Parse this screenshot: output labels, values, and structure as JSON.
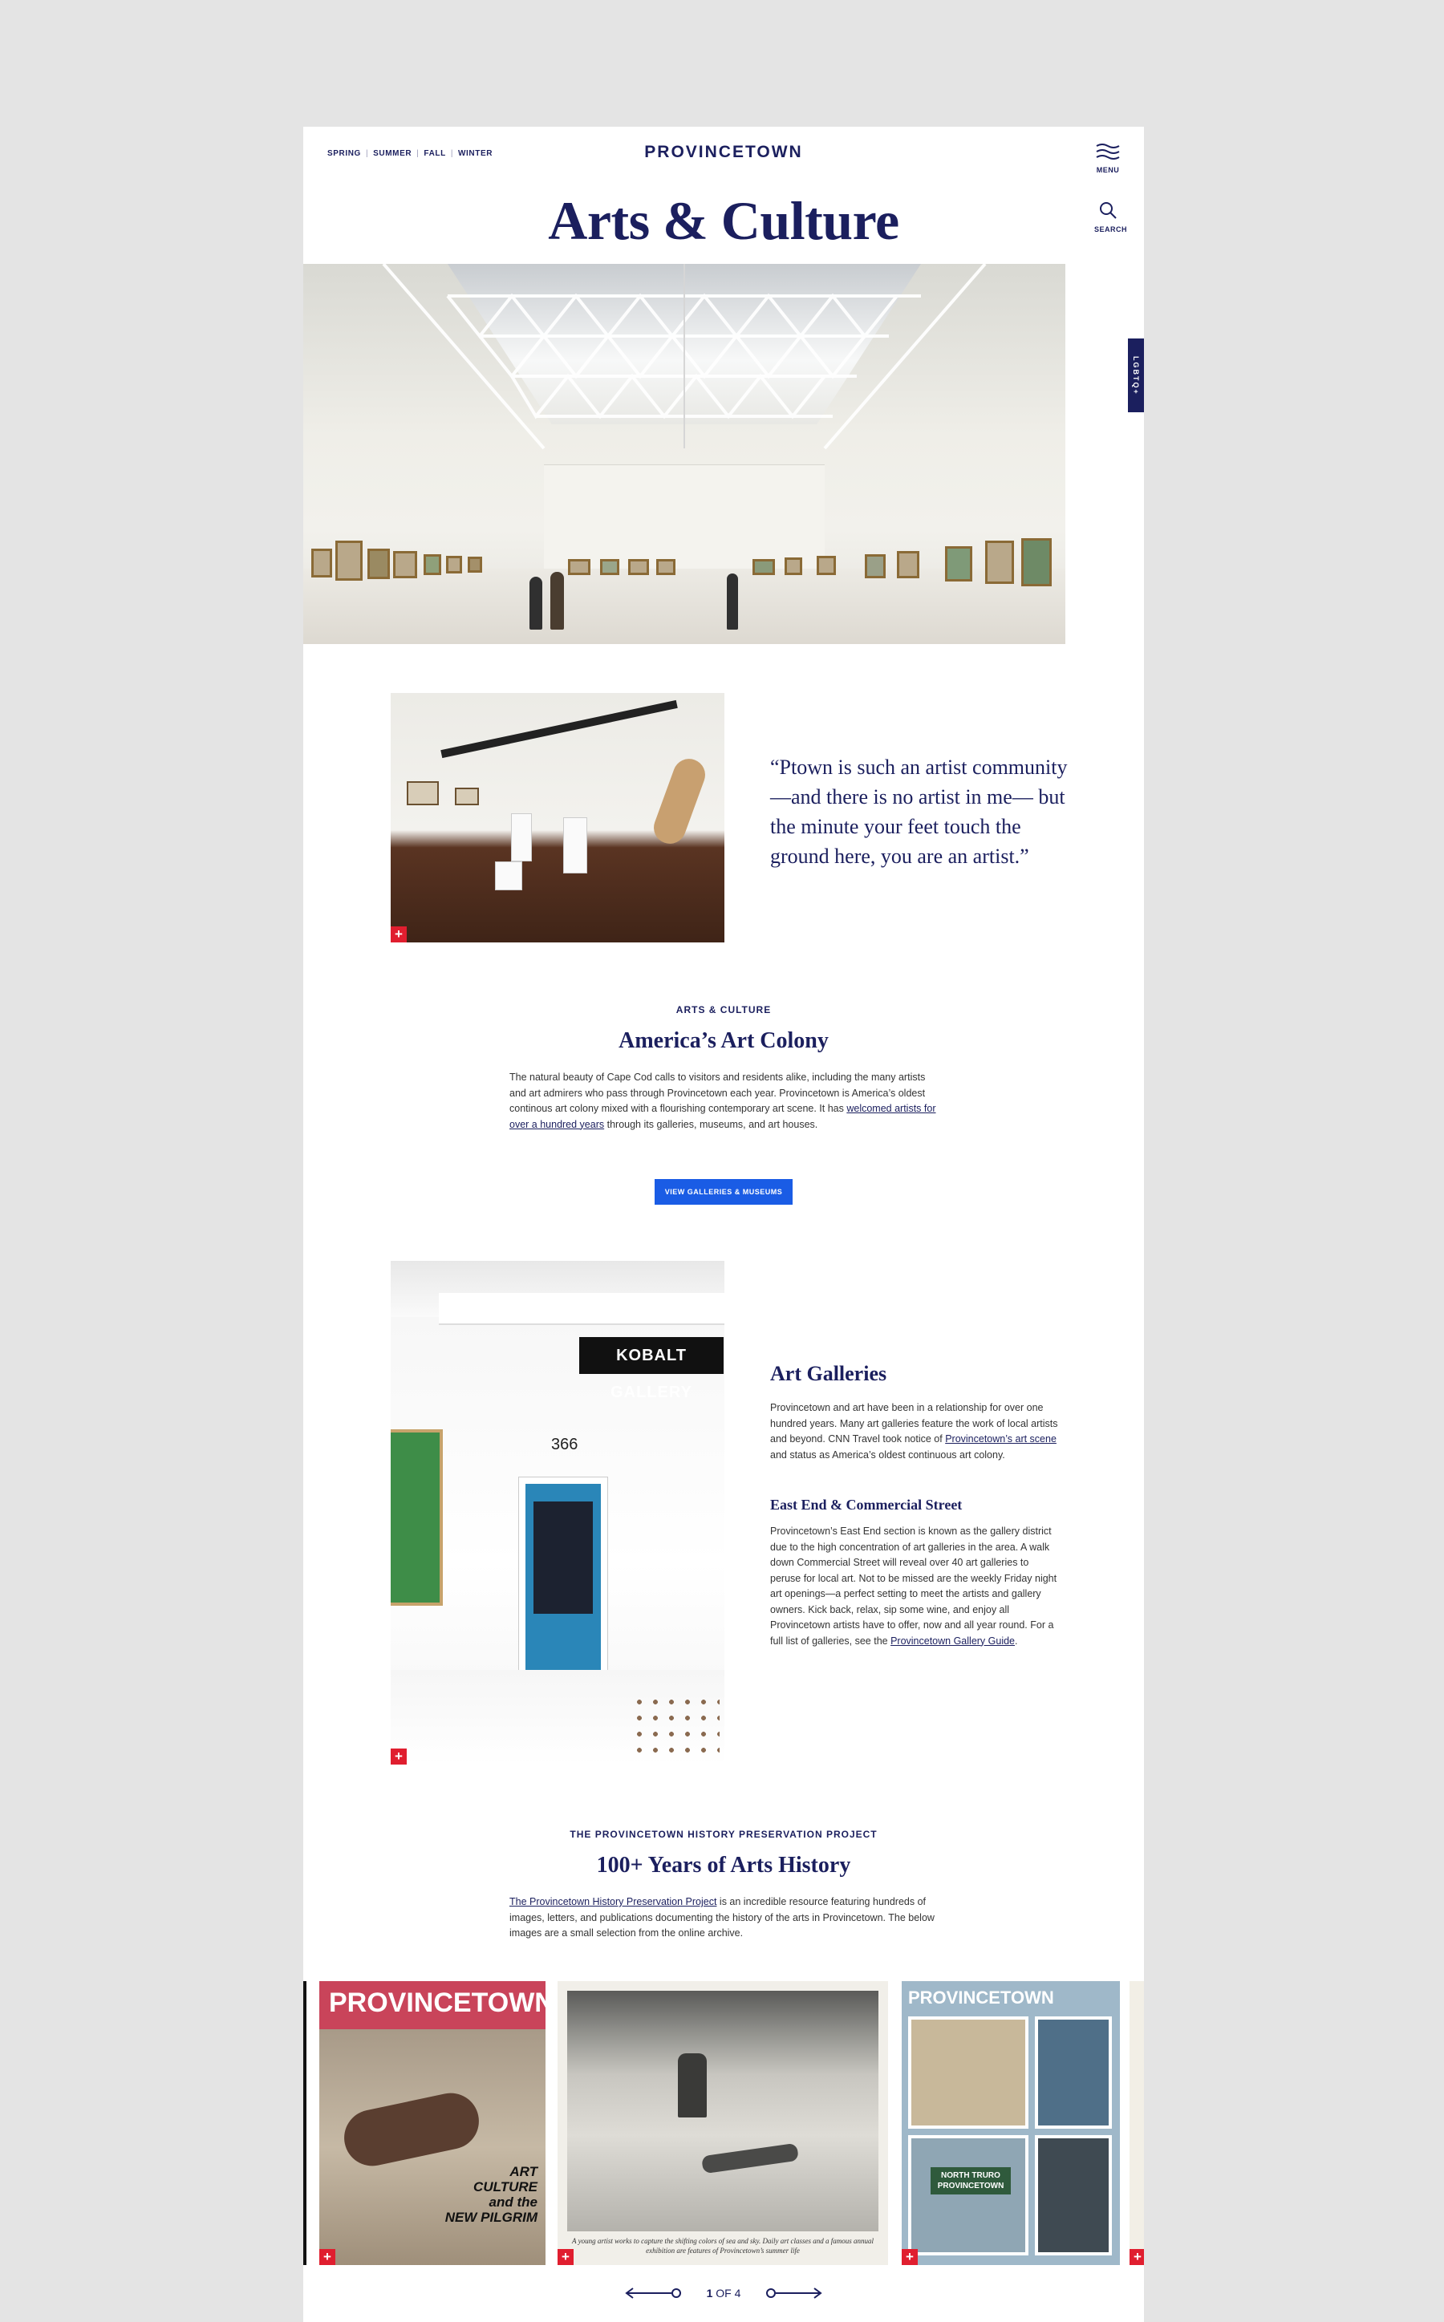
{
  "header": {
    "seasons": [
      "SPRING",
      "SUMMER",
      "FALL",
      "WINTER"
    ],
    "logo": "PROVINCETOWN",
    "menu_label": "MENU",
    "search_label": "SEARCH",
    "title": "Arts & Culture",
    "side_tab": "LGBTQ+"
  },
  "quote": {
    "text": "“Ptown is such an artist community —and there is no artist in me— but the minute your feet touch the ground here, you are an artist.”"
  },
  "colony": {
    "eyebrow": "ARTS & CULTURE",
    "title": "America’s Art Colony",
    "body_before": "The natural beauty of Cape Cod calls to visitors and residents alike, including the many artists and art admirers who pass through Provincetown each year. Provincetown is America’s oldest continous art colony mixed with a flourishing contemporary art scene. It has ",
    "link": "welcomed artists for over a hundred years",
    "body_after": " through its galleries, museums, and art houses.",
    "cta": "VIEW GALLERIES & MUSEUMS"
  },
  "galleries": {
    "sign": "KOBALT GALLERY",
    "number": "366",
    "title": "Art Galleries",
    "body_before": "Provincetown and art have been in a relationship for over one hundred years. Many art galleries feature the work of local artists and beyond. CNN Travel took notice of ",
    "link": "Provincetown’s art scene",
    "body_after": " and status as America’s oldest continuous art colony.",
    "sub_title": "East End & Commercial Street",
    "sub_body_before": "Provincetown’s East End section is known as the gallery district due to the high concentration of art galleries in the area. A walk down Commercial Street will reveal over 40 art galleries to peruse for local art. Not to be missed are the weekly Friday night art openings—a perfect setting to meet the artists and gallery owners. Kick back, relax, sip some wine, and enjoy all Provincetown artists have to offer, now and all year round. For a full list of galleries, see the ",
    "sub_link": "Provincetown Gallery Guide",
    "sub_body_after": "."
  },
  "history": {
    "eyebrow": "THE PROVINCETOWN HISTORY PRESERVATION PROJECT",
    "title": "100+ Years of Arts History",
    "link": "The Provincetown History Preservation Project",
    "body_after": " is an incredible resource featuring hundreds of images, letters, and publications documenting the history of the arts in Provincetown. The below images are a small selection from the online archive."
  },
  "carousel": {
    "card1": {
      "masthead": "PROVINCETOWN",
      "tagline_lines": [
        "ART",
        "CULTURE",
        "and the",
        "NEW PILGRIM"
      ]
    },
    "card2": {
      "caption": "A young artist works to capture the shifting colors of sea and sky. Daily art classes and a famous annual exhibition are features of Provincetown’s summer life"
    },
    "card3": {
      "masthead": "PROVINCETOWN",
      "sign_lines": [
        "NORTH TRURO",
        "PROVINCETOWN"
      ]
    },
    "page_current": "1",
    "page_of": "OF",
    "page_total": "4"
  },
  "colors": {
    "navy": "#1b1f5e",
    "accent_red": "#e01e2f",
    "cta_blue": "#1a5ce5",
    "backdrop": "#e4e4e4"
  }
}
